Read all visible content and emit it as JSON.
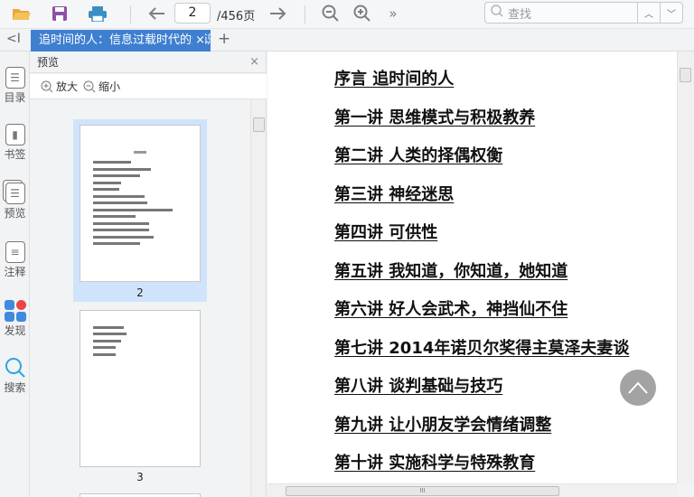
{
  "toolbar": {
    "page_current": "2",
    "page_total": "/456页",
    "search_placeholder": "查找",
    "more": "»"
  },
  "tab": {
    "title": "追时间的人：信息过载时代的知识",
    "close": "×",
    "add": "+",
    "collapse": "<I"
  },
  "rail": [
    {
      "label": "目录"
    },
    {
      "label": "书签"
    },
    {
      "label": "预览"
    },
    {
      "label": "注释"
    },
    {
      "label": "发现"
    },
    {
      "label": "搜索"
    }
  ],
  "panel": {
    "title": "预览",
    "close": "×",
    "zoom_in": "放大",
    "zoom_out": "缩小",
    "thumbs": [
      {
        "label": "2"
      },
      {
        "label": "3"
      }
    ]
  },
  "toc": [
    "序言 追时间的人",
    "第一讲 思维模式与积极教养",
    "第二讲 人类的择偶权衡",
    "第三讲 神经迷思",
    "第四讲 可供性",
    "第五讲 我知道，你知道，她知道",
    "第六讲 好人会武术，神挡仙不住",
    "第七讲 2014年诺贝尔奖得主莫泽夫妻谈",
    "第八讲 谈判基础与技巧",
    "第九讲 让小朋友学会情绪调整",
    "第十讲 实施科学与特殊教育"
  ],
  "colors": {
    "accent": "#3f7fd0",
    "selection": "#cfe4fb"
  }
}
